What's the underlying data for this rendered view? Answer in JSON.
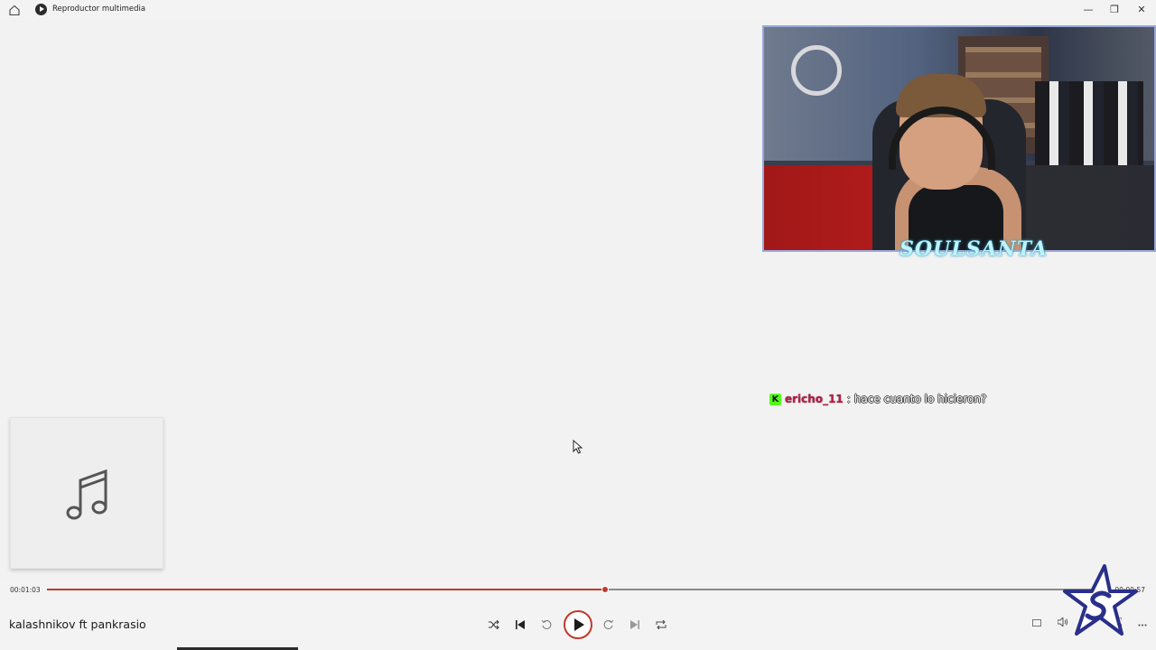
{
  "window": {
    "title": "Reproductor multimedia",
    "controls": [
      "—",
      "❐",
      "✕"
    ]
  },
  "overlay": {
    "logo_text": "SOULSANTA",
    "chat": {
      "badge": "K",
      "username": "ericho_11",
      "separator": ":",
      "message": "hace cuanto lo hicieron?"
    }
  },
  "player": {
    "song_title": "kalashnikov ft pankrasio",
    "time_elapsed": "00:01:03",
    "time_remaining": "00:00:57",
    "progress": 0.525,
    "accent_color": "#c0392b",
    "controls": {
      "shuffle": "shuffle-icon",
      "previous": "previous-icon",
      "skip_back": "skip-back-10-icon",
      "play": "play-icon",
      "skip_forward": "skip-forward-30-icon",
      "next": "next-icon",
      "repeat": "repeat-icon"
    },
    "right_controls": [
      "miniplayer-icon",
      "volume-icon",
      "fullscreen-icon",
      "more-icon"
    ]
  }
}
